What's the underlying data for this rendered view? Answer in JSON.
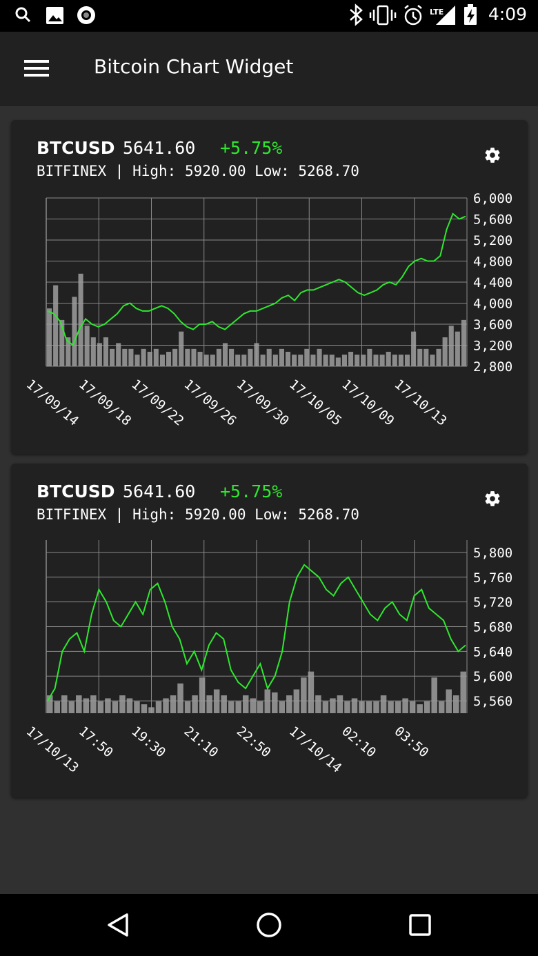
{
  "status_bar": {
    "time": "4:09",
    "left_icons": [
      "search-icon",
      "image-icon",
      "record-icon"
    ],
    "right_icons": [
      "bluetooth-icon",
      "vibrate-icon",
      "alarm-icon",
      "lte-signal-icon",
      "battery-charging-icon"
    ],
    "network_label": "LTE"
  },
  "app_bar": {
    "title": "Bitcoin Chart Widget"
  },
  "colors": {
    "line": "#2ee82e",
    "volume": "#9e9e9e",
    "grid": "#8a8a8a",
    "card": "#212121"
  },
  "widgets": [
    {
      "symbol": "BTCUSD",
      "price": "5641.60",
      "change": "+5.75%",
      "exchange": "BITFINEX",
      "high_label": "High:",
      "high": "5920.00",
      "low_label": "Low:",
      "low": "5268.70",
      "chart_data": {
        "type": "line",
        "ylim": [
          2800,
          6000
        ],
        "y_ticks": [
          "6,000",
          "5,600",
          "5,200",
          "4,800",
          "4,400",
          "4,000",
          "3,600",
          "3,200",
          "2,800"
        ],
        "x_ticks": [
          "17/09/14",
          "17/09/18",
          "17/09/22",
          "17/09/26",
          "17/09/30",
          "17/10/05",
          "17/10/09",
          "17/10/13"
        ],
        "price": [
          3850,
          3800,
          3650,
          3300,
          3200,
          3500,
          3700,
          3600,
          3550,
          3600,
          3700,
          3800,
          3950,
          4000,
          3900,
          3850,
          3850,
          3900,
          3950,
          3900,
          3800,
          3650,
          3550,
          3500,
          3600,
          3600,
          3650,
          3550,
          3500,
          3600,
          3700,
          3800,
          3850,
          3850,
          3900,
          3950,
          4000,
          4100,
          4150,
          4050,
          4200,
          4250,
          4250,
          4300,
          4350,
          4400,
          4450,
          4400,
          4300,
          4200,
          4150,
          4200,
          4250,
          4350,
          4400,
          4350,
          4500,
          4700,
          4800,
          4850,
          4800,
          4800,
          4900,
          5400,
          5700,
          5600,
          5650
        ],
        "volume": [
          1.0,
          1.4,
          0.8,
          0.5,
          1.2,
          1.6,
          0.7,
          0.5,
          0.4,
          0.5,
          0.3,
          0.4,
          0.3,
          0.3,
          0.2,
          0.3,
          0.25,
          0.3,
          0.2,
          0.25,
          0.3,
          0.6,
          0.3,
          0.3,
          0.25,
          0.2,
          0.2,
          0.3,
          0.4,
          0.3,
          0.2,
          0.2,
          0.3,
          0.4,
          0.2,
          0.3,
          0.2,
          0.3,
          0.25,
          0.2,
          0.2,
          0.3,
          0.2,
          0.3,
          0.2,
          0.2,
          0.15,
          0.2,
          0.25,
          0.2,
          0.2,
          0.3,
          0.2,
          0.2,
          0.25,
          0.2,
          0.2,
          0.2,
          0.6,
          0.3,
          0.3,
          0.2,
          0.3,
          0.5,
          0.7,
          0.6,
          0.8
        ]
      }
    },
    {
      "symbol": "BTCUSD",
      "price": "5641.60",
      "change": "+5.75%",
      "exchange": "BITFINEX",
      "high_label": "High:",
      "high": "5920.00",
      "low_label": "Low:",
      "low": "5268.70",
      "chart_data": {
        "type": "line",
        "ylim": [
          5540,
          5820
        ],
        "y_ticks": [
          "5,800",
          "5,760",
          "5,720",
          "5,680",
          "5,640",
          "5,600",
          "5,560"
        ],
        "x_ticks": [
          "17/10/13",
          "17:50",
          "19:30",
          "21:10",
          "22:50",
          "17/10/14",
          "02:10",
          "03:50"
        ],
        "price": [
          5560,
          5580,
          5640,
          5660,
          5670,
          5640,
          5700,
          5740,
          5720,
          5690,
          5680,
          5700,
          5720,
          5700,
          5740,
          5750,
          5720,
          5680,
          5660,
          5620,
          5640,
          5610,
          5650,
          5670,
          5660,
          5610,
          5590,
          5580,
          5600,
          5620,
          5580,
          5600,
          5640,
          5720,
          5760,
          5780,
          5770,
          5760,
          5740,
          5730,
          5750,
          5760,
          5740,
          5720,
          5700,
          5690,
          5710,
          5720,
          5700,
          5690,
          5730,
          5740,
          5710,
          5700,
          5690,
          5660,
          5640,
          5650
        ]
      },
      "volume_data": [
        0.3,
        0.2,
        0.3,
        0.2,
        0.3,
        0.25,
        0.3,
        0.2,
        0.25,
        0.2,
        0.3,
        0.25,
        0.2,
        0.15,
        0.1,
        0.2,
        0.25,
        0.3,
        0.5,
        0.2,
        0.3,
        0.6,
        0.3,
        0.4,
        0.3,
        0.2,
        0.2,
        0.3,
        0.25,
        0.2,
        0.4,
        0.35,
        0.2,
        0.3,
        0.4,
        0.6,
        0.7,
        0.3,
        0.2,
        0.25,
        0.3,
        0.2,
        0.25,
        0.2,
        0.2,
        0.2,
        0.3,
        0.2,
        0.2,
        0.25,
        0.2,
        0.15,
        0.2,
        0.6,
        0.2,
        0.4,
        0.3,
        0.7
      ]
    }
  ],
  "nav_bar": {
    "buttons": [
      "back-icon",
      "home-icon",
      "recents-icon"
    ]
  }
}
